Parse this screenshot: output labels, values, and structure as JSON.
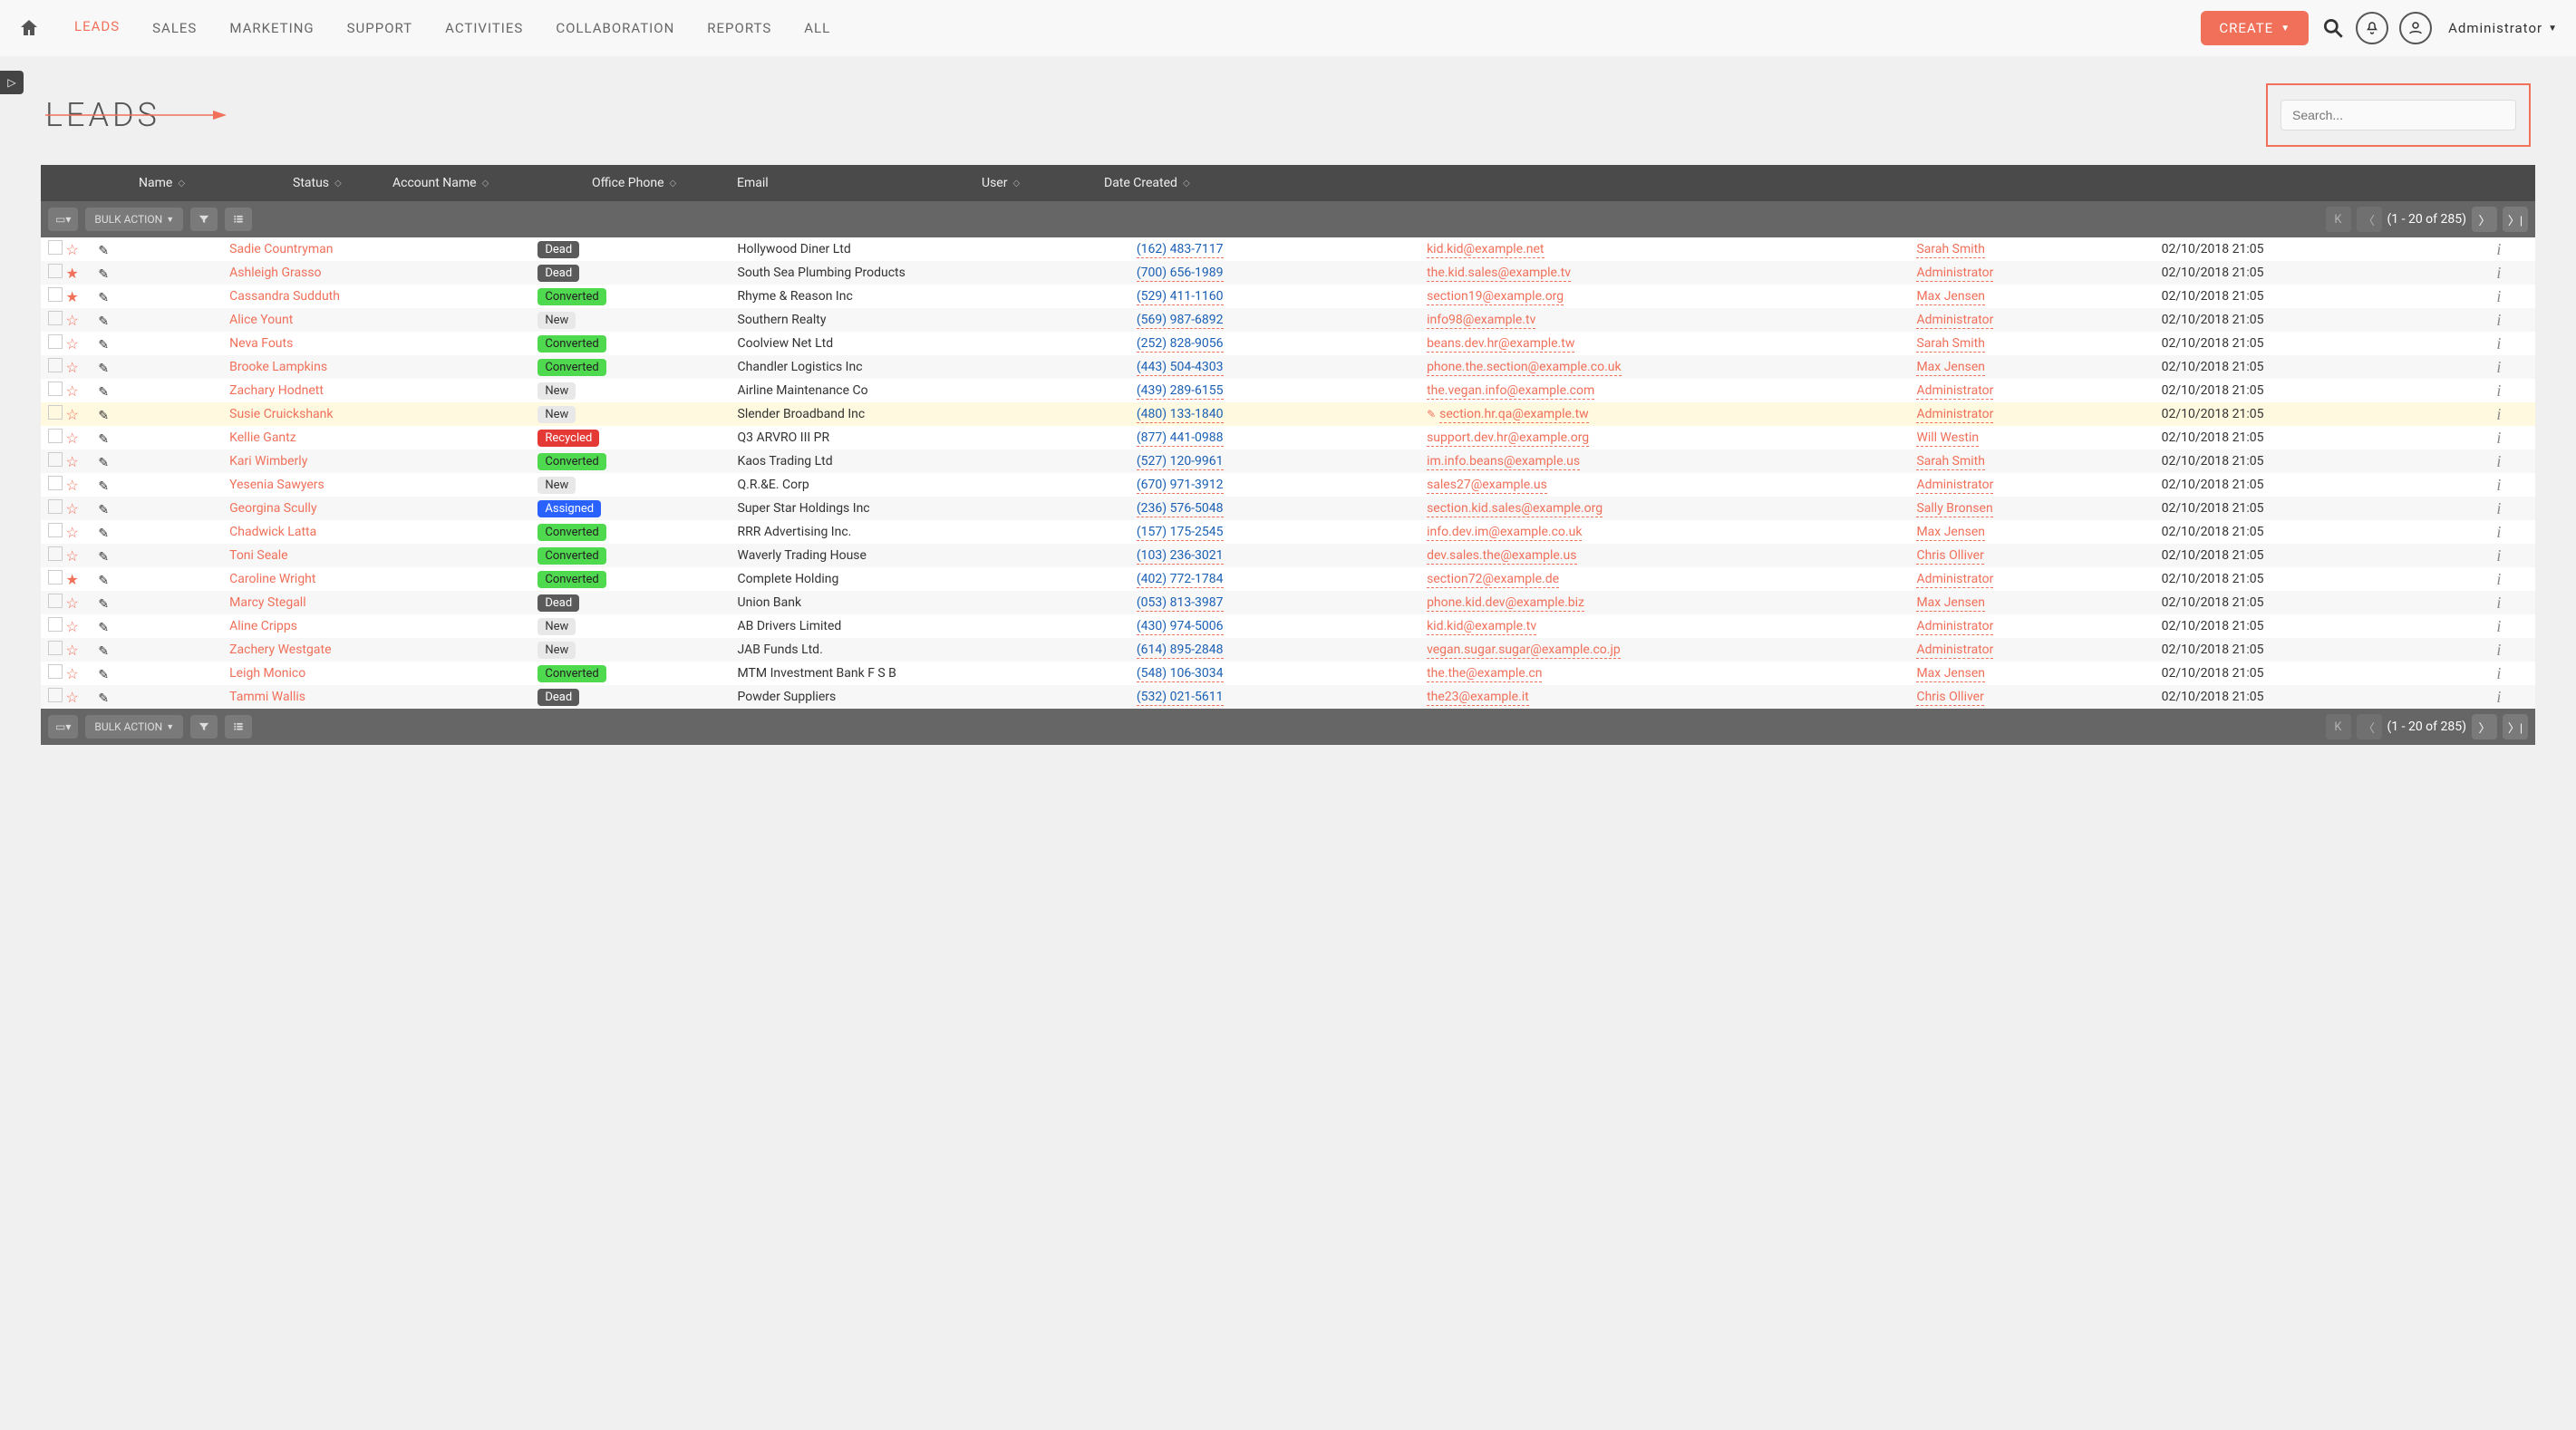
{
  "nav": {
    "items": [
      "LEADS",
      "SALES",
      "MARKETING",
      "SUPPORT",
      "ACTIVITIES",
      "COLLABORATION",
      "REPORTS",
      "ALL"
    ],
    "active_index": 0,
    "create_label": "CREATE",
    "admin_label": "Administrator"
  },
  "page": {
    "title": "LEADS",
    "search_placeholder": "Search..."
  },
  "columns": [
    "Name",
    "Status",
    "Account Name",
    "Office Phone",
    "Email",
    "User",
    "Date Created"
  ],
  "toolbar": {
    "bulk_label": "BULK ACTION",
    "pager_text": "(1 - 20 of 285)"
  },
  "rows": [
    {
      "starred": false,
      "name": "Sadie Countryman",
      "status": "Dead",
      "account": "Hollywood Diner Ltd",
      "phone": "(162) 483-7117",
      "email": "kid.kid@example.net",
      "user": "Sarah Smith",
      "date": "02/10/2018 21:05"
    },
    {
      "starred": true,
      "name": "Ashleigh Grasso",
      "status": "Dead",
      "account": "South Sea Plumbing Products",
      "phone": "(700) 656-1989",
      "email": "the.kid.sales@example.tv",
      "user": "Administrator",
      "date": "02/10/2018 21:05"
    },
    {
      "starred": true,
      "name": "Cassandra Sudduth",
      "status": "Converted",
      "account": "Rhyme & Reason Inc",
      "phone": "(529) 411-1160",
      "email": "section19@example.org",
      "user": "Max Jensen",
      "date": "02/10/2018 21:05"
    },
    {
      "starred": false,
      "name": "Alice Yount",
      "status": "New",
      "account": "Southern Realty",
      "phone": "(569) 987-6892",
      "email": "info98@example.tv",
      "user": "Administrator",
      "date": "02/10/2018 21:05"
    },
    {
      "starred": false,
      "name": "Neva Fouts",
      "status": "Converted",
      "account": "Coolview Net Ltd",
      "phone": "(252) 828-9056",
      "email": "beans.dev.hr@example.tw",
      "user": "Sarah Smith",
      "date": "02/10/2018 21:05"
    },
    {
      "starred": false,
      "name": "Brooke Lampkins",
      "status": "Converted",
      "account": "Chandler Logistics Inc",
      "phone": "(443) 504-4303",
      "email": "phone.the.section@example.co.uk",
      "user": "Max Jensen",
      "date": "02/10/2018 21:05"
    },
    {
      "starred": false,
      "name": "Zachary Hodnett",
      "status": "New",
      "account": "Airline Maintenance Co",
      "phone": "(439) 289-6155",
      "email": "the.vegan.info@example.com",
      "user": "Administrator",
      "date": "02/10/2018 21:05"
    },
    {
      "starred": false,
      "name": "Susie Cruickshank",
      "status": "New",
      "account": "Slender Broadband Inc",
      "phone": "(480) 133-1840",
      "email": "section.hr.qa@example.tw",
      "user": "Administrator",
      "date": "02/10/2018 21:05",
      "highlight": true,
      "email_edit": true
    },
    {
      "starred": false,
      "name": "Kellie Gantz",
      "status": "Recycled",
      "account": "Q3 ARVRO III PR",
      "phone": "(877) 441-0988",
      "email": "support.dev.hr@example.org",
      "user": "Will Westin",
      "date": "02/10/2018 21:05"
    },
    {
      "starred": false,
      "name": "Kari Wimberly",
      "status": "Converted",
      "account": "Kaos Trading Ltd",
      "phone": "(527) 120-9961",
      "email": "im.info.beans@example.us",
      "user": "Sarah Smith",
      "date": "02/10/2018 21:05"
    },
    {
      "starred": false,
      "name": "Yesenia Sawyers",
      "status": "New",
      "account": "Q.R.&E. Corp",
      "phone": "(670) 971-3912",
      "email": "sales27@example.us",
      "user": "Administrator",
      "date": "02/10/2018 21:05"
    },
    {
      "starred": false,
      "name": "Georgina Scully",
      "status": "Assigned",
      "account": "Super Star Holdings Inc",
      "phone": "(236) 576-5048",
      "email": "section.kid.sales@example.org",
      "user": "Sally Bronsen",
      "date": "02/10/2018 21:05"
    },
    {
      "starred": false,
      "name": "Chadwick Latta",
      "status": "Converted",
      "account": "RRR Advertising Inc.",
      "phone": "(157) 175-2545",
      "email": "info.dev.im@example.co.uk",
      "user": "Max Jensen",
      "date": "02/10/2018 21:05"
    },
    {
      "starred": false,
      "name": "Toni Seale",
      "status": "Converted",
      "account": "Waverly Trading House",
      "phone": "(103) 236-3021",
      "email": "dev.sales.the@example.us",
      "user": "Chris Olliver",
      "date": "02/10/2018 21:05"
    },
    {
      "starred": true,
      "name": "Caroline Wright",
      "status": "Converted",
      "account": "Complete Holding",
      "phone": "(402) 772-1784",
      "email": "section72@example.de",
      "user": "Administrator",
      "date": "02/10/2018 21:05"
    },
    {
      "starred": false,
      "name": "Marcy Stegall",
      "status": "Dead",
      "account": "Union Bank",
      "phone": "(053) 813-3987",
      "email": "phone.kid.dev@example.biz",
      "user": "Max Jensen",
      "date": "02/10/2018 21:05"
    },
    {
      "starred": false,
      "name": "Aline Cripps",
      "status": "New",
      "account": "AB Drivers Limited",
      "phone": "(430) 974-5006",
      "email": "kid.kid@example.tv",
      "user": "Administrator",
      "date": "02/10/2018 21:05"
    },
    {
      "starred": false,
      "name": "Zachery Westgate",
      "status": "New",
      "account": "JAB Funds Ltd.",
      "phone": "(614) 895-2848",
      "email": "vegan.sugar.sugar@example.co.jp",
      "user": "Administrator",
      "date": "02/10/2018 21:05"
    },
    {
      "starred": false,
      "name": "Leigh Monico",
      "status": "Converted",
      "account": "MTM Investment Bank F S B",
      "phone": "(548) 106-3034",
      "email": "the.the@example.cn",
      "user": "Max Jensen",
      "date": "02/10/2018 21:05"
    },
    {
      "starred": false,
      "name": "Tammi Wallis",
      "status": "Dead",
      "account": "Powder Suppliers",
      "phone": "(532) 021-5611",
      "email": "the23@example.it",
      "user": "Chris Olliver",
      "date": "02/10/2018 21:05"
    }
  ]
}
